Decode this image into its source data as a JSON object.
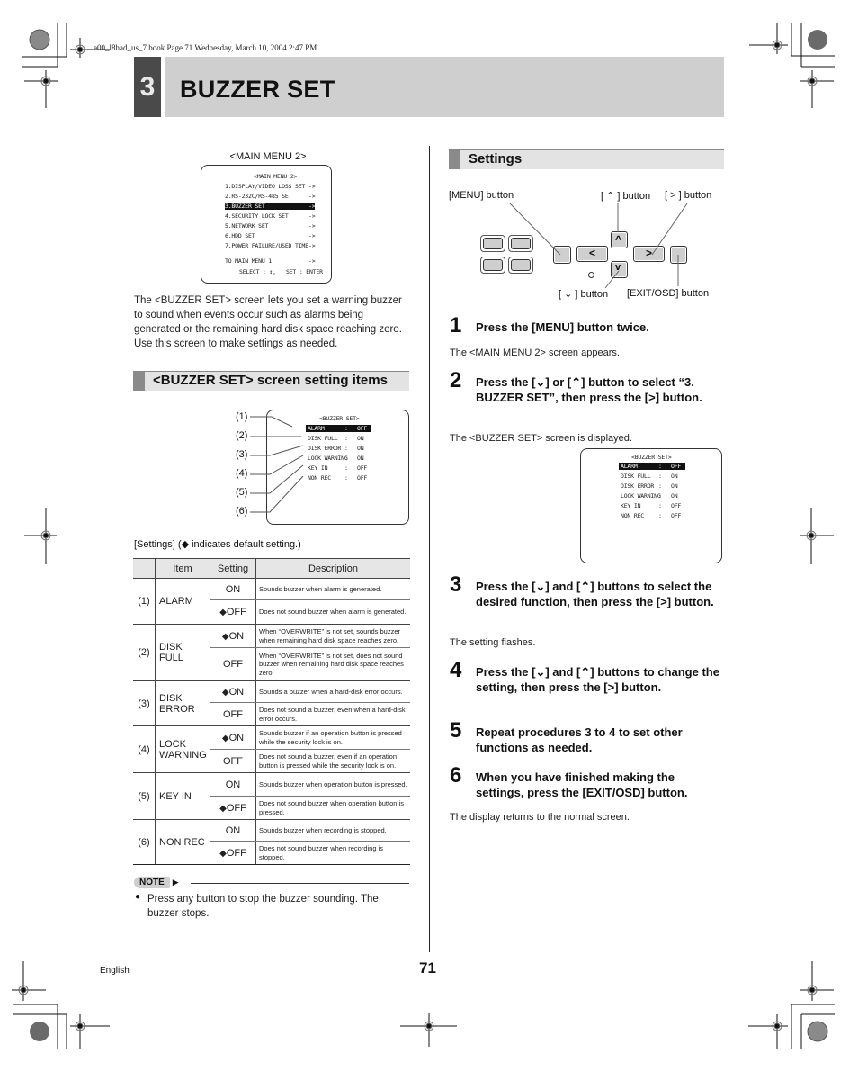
{
  "book_line": "e00_l8had_us_7.book  Page 71  Wednesday, March 10, 2004  2:47 PM",
  "chapter": {
    "number": "3",
    "title": "BUZZER SET"
  },
  "main_menu_2": {
    "caption": "<MAIN MENU 2>",
    "screen_title": "<MAIN MENU 2>",
    "items": [
      {
        "label": "1.DISPLAY/VIDEO LOSS SET",
        "arrow": "->"
      },
      {
        "label": "2.RS-232C/RS-485 SET",
        "arrow": "->"
      },
      {
        "label": "3.BUZZER SET",
        "arrow": "->",
        "selected": true
      },
      {
        "label": "4.SECURITY LOCK SET",
        "arrow": "->"
      },
      {
        "label": "5.NETWORK SET",
        "arrow": "->"
      },
      {
        "label": "6.HDD SET",
        "arrow": "->"
      },
      {
        "label": "7.POWER FAILURE/USED TIME",
        "arrow": "->"
      }
    ],
    "back": {
      "label": "TO MAIN MENU 1",
      "arrow": "->"
    },
    "footer": "SELECT : ↕,   SET : ENTER"
  },
  "intro": "The <BUZZER SET> screen lets you set a warning buzzer to sound when events occur such as alarms being generated or the remaining hard disk space reaching zero. Use this screen to make settings as needed.",
  "section_items": {
    "heading": "<BUZZER SET> screen setting items"
  },
  "buzzer_screen": {
    "title": "<BUZZER SET>",
    "rows": [
      {
        "callout": "(1)",
        "label": "ALARM",
        "sep": ":",
        "value": "OFF",
        "selected": true
      },
      {
        "callout": "(2)",
        "label": "DISK FULL",
        "sep": ":",
        "value": "ON"
      },
      {
        "callout": "(3)",
        "label": "DISK ERROR",
        "sep": ":",
        "value": "ON"
      },
      {
        "callout": "(4)",
        "label": "LOCK WARNING",
        "sep": ":",
        "value": "ON"
      },
      {
        "callout": "(5)",
        "label": "KEY IN",
        "sep": ":",
        "value": "OFF"
      },
      {
        "callout": "(6)",
        "label": "NON REC",
        "sep": ":",
        "value": "OFF"
      }
    ]
  },
  "settings_note": "[Settings] (◆ indicates default setting.)",
  "table": {
    "headers": [
      "",
      "Item",
      "Setting",
      "Description"
    ],
    "groups": [
      {
        "num": "(1)",
        "item": "ALARM",
        "options": [
          {
            "setting": "ON",
            "default": false,
            "desc": "Sounds buzzer when alarm is generated."
          },
          {
            "setting": "OFF",
            "default": true,
            "desc": "Does not sound buzzer when alarm is generated."
          }
        ]
      },
      {
        "num": "(2)",
        "item": "DISK FULL",
        "options": [
          {
            "setting": "ON",
            "default": true,
            "desc": "When “OVERWRITE” is not set, sounds buzzer when remaining hard disk space reaches zero."
          },
          {
            "setting": "OFF",
            "default": false,
            "desc": "When “OVERWRITE” is not set, does not sound buzzer when remaining hard disk space reaches zero."
          }
        ]
      },
      {
        "num": "(3)",
        "item": "DISK ERROR",
        "options": [
          {
            "setting": "ON",
            "default": true,
            "desc": "Sounds a buzzer when a hard-disk error occurs."
          },
          {
            "setting": "OFF",
            "default": false,
            "desc": "Does not sound a buzzer, even when a hard-disk error occurs."
          }
        ]
      },
      {
        "num": "(4)",
        "item": "LOCK WARNING",
        "options": [
          {
            "setting": "ON",
            "default": true,
            "desc": "Sounds buzzer if an operation button is pressed while the security lock is on."
          },
          {
            "setting": "OFF",
            "default": false,
            "desc": "Does not sound a buzzer, even if an operation button is pressed while the security lock is on."
          }
        ]
      },
      {
        "num": "(5)",
        "item": "KEY IN",
        "options": [
          {
            "setting": "ON",
            "default": false,
            "desc": "Sounds buzzer when operation button is pressed."
          },
          {
            "setting": "OFF",
            "default": true,
            "desc": "Does not sound buzzer when operation button is pressed."
          }
        ]
      },
      {
        "num": "(6)",
        "item": "NON REC",
        "options": [
          {
            "setting": "ON",
            "default": false,
            "desc": "Sounds buzzer when recording is stopped."
          },
          {
            "setting": "OFF",
            "default": true,
            "desc": "Does not sound buzzer when recording is stopped."
          }
        ]
      }
    ]
  },
  "note": {
    "badge": "NOTE",
    "text": "Press any button to stop the buzzer sounding. The buzzer stops."
  },
  "settings_section": {
    "heading": "Settings",
    "labels": {
      "menu": "[MENU] button",
      "up": "[ ⌃ ] button",
      "right": "[ > ] button",
      "down": "[ ⌄ ] button",
      "exit": "[EXIT/OSD] button"
    },
    "glyphs": {
      "left": "<",
      "right": ">",
      "up": "^",
      "down": "v"
    }
  },
  "steps": [
    {
      "num": "1",
      "text": "Press the [MENU] button twice.",
      "result": "The <MAIN MENU 2> screen appears."
    },
    {
      "num": "2",
      "text": "Press the [⌄] or [⌃] button to select “3. BUZZER SET”, then press the [>] button.",
      "result": "The <BUZZER SET> screen is displayed."
    },
    {
      "num": "3",
      "text": "Press the [⌄] and [⌃] buttons to select the desired function, then press the [>] button.",
      "result": "The setting flashes."
    },
    {
      "num": "4",
      "text": "Press the [⌄] and [⌃] buttons to change the setting, then press the [>] button.",
      "result": ""
    },
    {
      "num": "5",
      "text": "Repeat procedures 3 to 4 to set other functions as needed.",
      "result": ""
    },
    {
      "num": "6",
      "text": "When you have finished making the settings, press the [EXIT/OSD] button.",
      "result": "The display returns to the normal screen."
    }
  ],
  "footer": {
    "language": "English",
    "page": "71"
  }
}
